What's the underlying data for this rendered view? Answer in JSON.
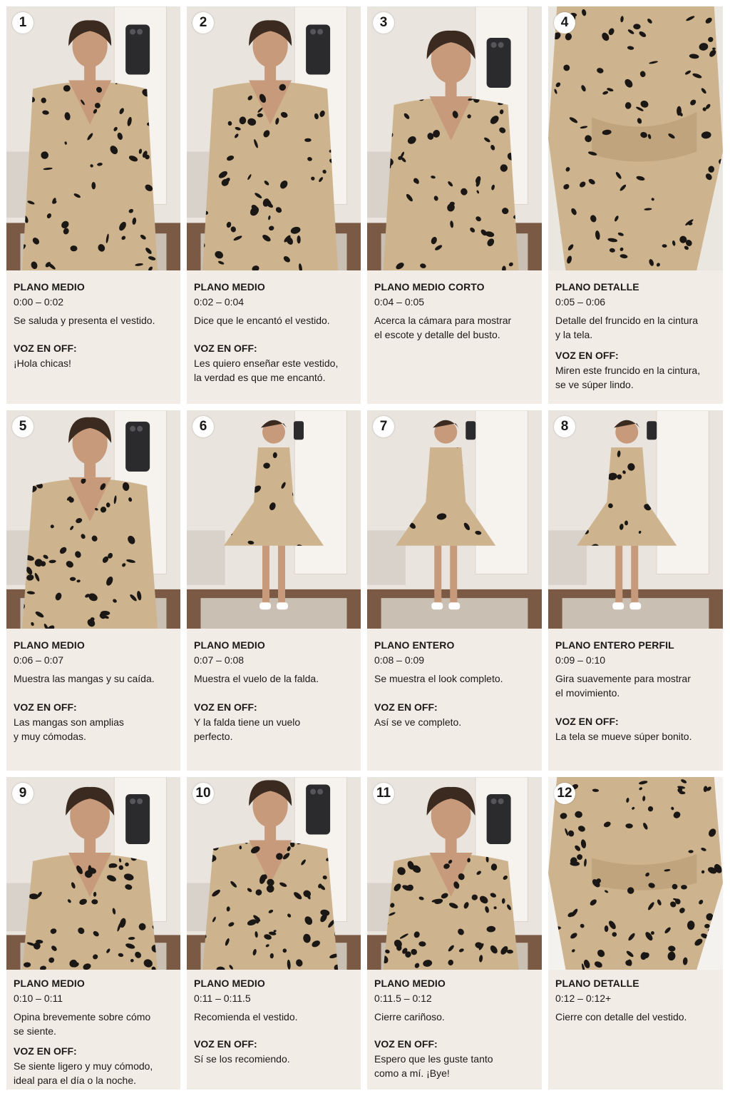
{
  "storyboard": {
    "scenes": [
      {
        "number": "1",
        "shot": "PLANO MEDIO",
        "time": "0:00 – 0:02",
        "description": "Se saluda y presenta el vestido.",
        "voice_label": "VOZ EN OFF:",
        "voice": "¡Hola chicas!"
      },
      {
        "number": "2",
        "shot": "PLANO MEDIO",
        "time": "0:02 – 0:04",
        "description": "Dice que le encantó el vestido.",
        "voice_label": "VOZ EN OFF:",
        "voice": "Les quiero enseñar este vestido,\nla verdad es que me encantó."
      },
      {
        "number": "3",
        "shot": "PLANO MEDIO CORTO",
        "time": "0:04 – 0:05",
        "description": "Acerca la cámara para mostrar\nel escote y detalle del busto.",
        "voice_label": "",
        "voice": ""
      },
      {
        "number": "4",
        "shot": "PLANO DETALLE",
        "time": "0:05 – 0:06",
        "description": "Detalle del fruncido en la cintura\ny la tela.",
        "voice_label": "VOZ EN OFF:",
        "voice": "Miren este fruncido en la cintura,\nse ve súper lindo."
      },
      {
        "number": "5",
        "shot": "PLANO MEDIO",
        "time": "0:06 – 0:07",
        "description": "Muestra las mangas y su caída.",
        "voice_label": "VOZ EN OFF:",
        "voice": "Las mangas son amplias\ny muy cómodas."
      },
      {
        "number": "6",
        "shot": "PLANO MEDIO",
        "time": "0:07 – 0:08",
        "description": "Muestra el vuelo de la falda.",
        "voice_label": "VOZ EN OFF:",
        "voice": "Y la falda tiene un vuelo\nperfecto."
      },
      {
        "number": "7",
        "shot": "PLANO ENTERO",
        "time": "0:08 – 0:09",
        "description": "Se muestra el look completo.",
        "voice_label": "VOZ EN OFF:",
        "voice": "Así se ve completo."
      },
      {
        "number": "8",
        "shot": "PLANO ENTERO PERFIL",
        "time": "0:09 – 0:10",
        "description": "Gira suavemente para mostrar\nel movimiento.",
        "voice_label": "VOZ EN OFF:",
        "voice": "La tela se mueve súper bonito."
      },
      {
        "number": "9",
        "shot": "PLANO MEDIO",
        "time": "0:10 – 0:11",
        "description": "Opina brevemente sobre cómo\nse siente.",
        "voice_label": "VOZ EN OFF:",
        "voice": "Se siente ligero y muy cómodo,\nideal para el día o la noche."
      },
      {
        "number": "10",
        "shot": "PLANO MEDIO",
        "time": "0:11 – 0:11.5",
        "description": "Recomienda el vestido.",
        "voice_label": "VOZ EN OFF:",
        "voice": "Sí se los recomiendo."
      },
      {
        "number": "11",
        "shot": "PLANO MEDIO",
        "time": "0:11.5 – 0:12",
        "description": "Cierre cariñoso.",
        "voice_label": "VOZ EN OFF:",
        "voice": "Espero que les guste tanto\ncomo a mí. ¡Bye!"
      },
      {
        "number": "12",
        "shot": "PLANO DETALLE",
        "time": "0:12 – 0:12+",
        "description": "Cierre con detalle del vestido.",
        "voice_label": "",
        "voice": ""
      }
    ]
  },
  "colors": {
    "card_background": "#f1ece5",
    "text": "#1c1a18",
    "badge": "#ffffff",
    "dress_fabric": "#cdb48f",
    "dress_print": "#1a1714"
  }
}
